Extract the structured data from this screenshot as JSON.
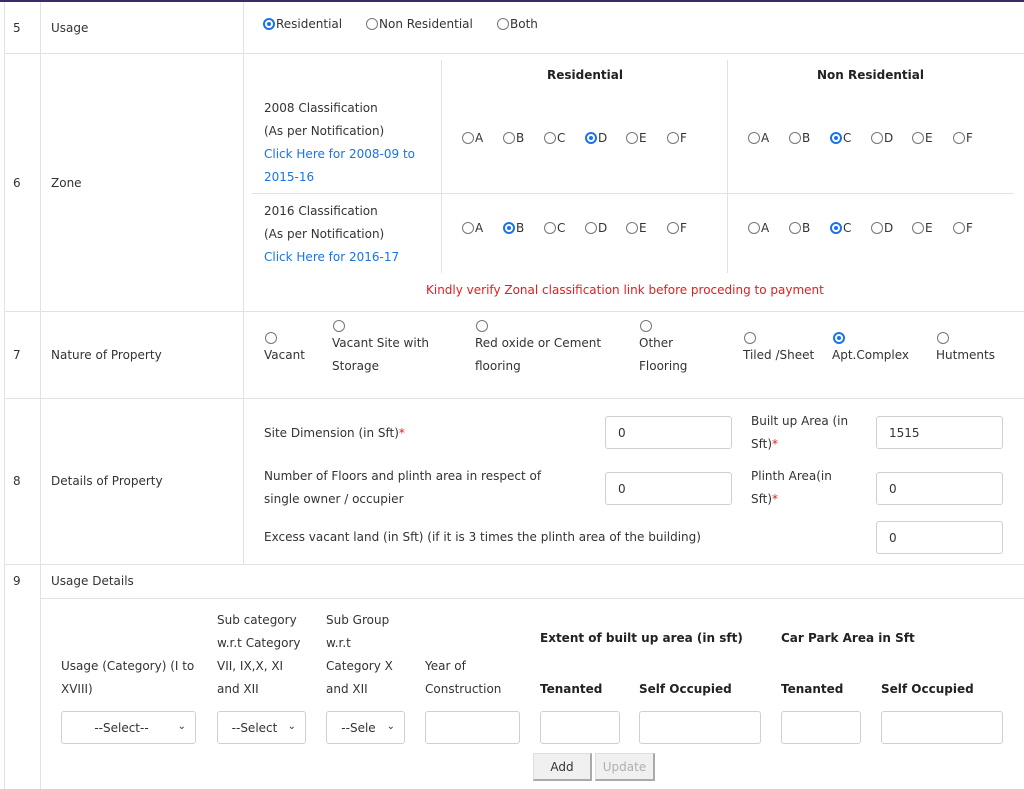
{
  "rows": {
    "usage": {
      "num": "5",
      "label": "Usage",
      "options": [
        "Residential",
        "Non Residential",
        "Both"
      ],
      "selected": "Residential"
    },
    "zone": {
      "num": "6",
      "label": "Zone",
      "col_residential": "Residential",
      "col_non_residential": "Non Residential",
      "classification_2008": {
        "title": "2008 Classification",
        "subtitle": "(As per Notification)",
        "link_line1": "Click Here for 2008-09 to",
        "link_line2": "2015-16",
        "residential_selected": "D",
        "non_residential_selected": "C"
      },
      "classification_2016": {
        "title": "2016 Classification",
        "subtitle": "(As per Notification)",
        "link": "Click Here for 2016-17",
        "residential_selected": "B",
        "non_residential_selected": "C"
      },
      "grades": [
        "A",
        "B",
        "C",
        "D",
        "E",
        "F"
      ],
      "warning": "Kindly verify Zonal classification link before proceding to payment"
    },
    "nature": {
      "num": "7",
      "label": "Nature of Property",
      "options": [
        {
          "line1": "Vacant",
          "line2": ""
        },
        {
          "line1": "Vacant Site with",
          "line2": "Storage"
        },
        {
          "line1": "Red oxide or Cement",
          "line2": "flooring"
        },
        {
          "line1": "Other",
          "line2": "Flooring"
        },
        {
          "line1": "Tiled /Sheet",
          "line2": ""
        },
        {
          "line1": "Apt.Complex",
          "line2": ""
        },
        {
          "line1": "Hutments",
          "line2": ""
        }
      ],
      "selected": "Apt.Complex"
    },
    "details": {
      "num": "8",
      "label": "Details of Property",
      "site_dimension_label": "Site Dimension (in Sft)",
      "site_dimension_value": "0",
      "floors_label_line1": "Number of Floors and plinth area in respect of",
      "floors_label_line2": "single owner / occupier",
      "floors_value": "0",
      "excess_label": "Excess vacant land (in Sft) (if it is 3 times the plinth area of the building)",
      "excess_value": "0",
      "built_up_label_line1": "Built up Area (in",
      "built_up_label_line2": "Sft)",
      "built_up_value": "1515",
      "plinth_label_line1": "Plinth Area(in",
      "plinth_label_line2": "Sft)",
      "plinth_value": "0",
      "required_mark": "*"
    },
    "usage_details": {
      "num": "9",
      "label": "Usage Details",
      "col_usage": [
        "Usage (Category) (I to",
        "XVIII)"
      ],
      "col_subcat": [
        "Sub category",
        "w.r.t Category",
        "VII, IX,X, XI",
        "and XII"
      ],
      "col_subgroup": [
        "Sub Group",
        "w.r.t",
        "Category X",
        "and XII"
      ],
      "col_year": [
        "Year of",
        "Construction"
      ],
      "col_extent": "Extent of built up area (in sft)",
      "col_carpark": "Car Park Area in Sft",
      "col_tenanted": "Tenanted",
      "col_self": "Self Occupied",
      "select_usage": "--Select--",
      "select_subcat": "--Select",
      "select_subgroup": "--Sele",
      "year_value": "",
      "extent_tenanted": "",
      "extent_self": "",
      "car_tenanted": "",
      "car_self": "",
      "add_label": "Add",
      "update_label": "Update"
    }
  }
}
